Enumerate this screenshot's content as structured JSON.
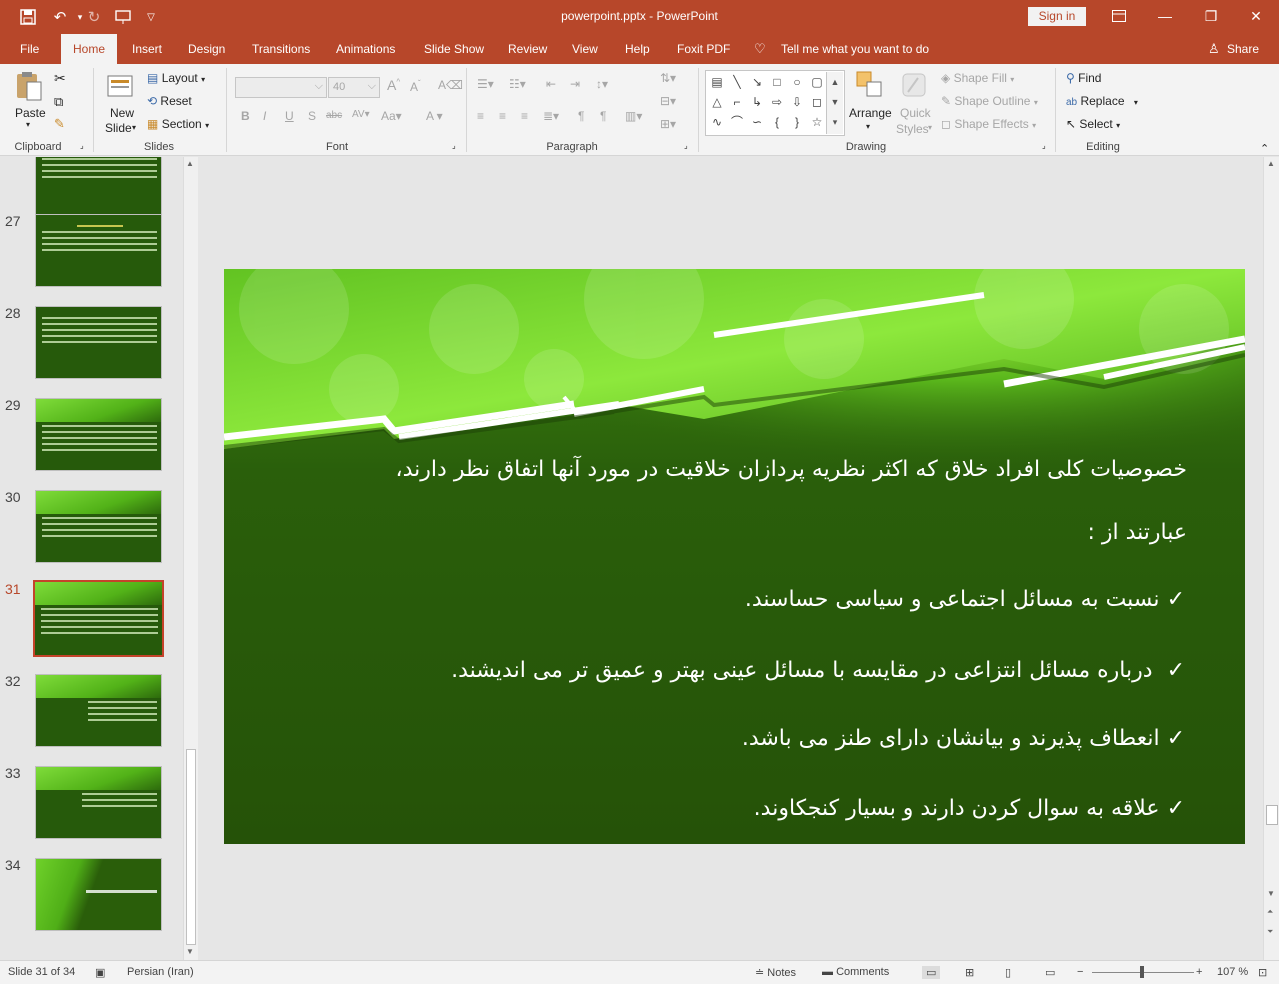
{
  "window": {
    "doc_title": "powerpoint.pptx  -  PowerPoint",
    "signin": "Sign in"
  },
  "tabs": [
    "File",
    "Home",
    "Insert",
    "Design",
    "Transitions",
    "Animations",
    "Slide Show",
    "Review",
    "View",
    "Help",
    "Foxit PDF"
  ],
  "active_tab": "Home",
  "tellme": "Tell me what you want to do",
  "share": "Share",
  "ribbon": {
    "clipboard": {
      "paste": "Paste",
      "label": "Clipboard"
    },
    "slides": {
      "new_slide": "New",
      "new_slide2": "Slide",
      "layout": "Layout",
      "reset": "Reset",
      "section": "Section",
      "label": "Slides"
    },
    "font": {
      "size": "40",
      "label": "Font"
    },
    "paragraph": {
      "label": "Paragraph"
    },
    "drawing": {
      "arrange": "Arrange",
      "quick_styles1": "Quick",
      "quick_styles2": "Styles",
      "shape_fill": "Shape Fill",
      "shape_outline": "Shape Outline",
      "shape_effects": "Shape Effects",
      "label": "Drawing"
    },
    "editing": {
      "find": "Find",
      "replace": "Replace",
      "select": "Select",
      "label": "Editing"
    }
  },
  "thumbnails": [
    {
      "num": "27"
    },
    {
      "num": "28"
    },
    {
      "num": "29"
    },
    {
      "num": "30"
    },
    {
      "num": "31"
    },
    {
      "num": "32"
    },
    {
      "num": "33"
    },
    {
      "num": "34"
    }
  ],
  "slide": {
    "line1": "خصوصیات کلی افراد خلاق که اکثر نظریه پردازان خلاقیت در مورد آنها اتفاق نظر دارند،",
    "line2": "عبارتند از :",
    "bullets": [
      "نسبت به مسائل اجتماعی و سیاسی حساسند.",
      "درباره مسائل انتزاعی در مقایسه با مسائل عینی بهتر و عمیق تر می اندیشند.",
      "انعطاف پذیرند و بیانشان دارای طنز می باشد.",
      "علاقه به سوال کردن دارند و بسیار کنجکاوند."
    ],
    "check": "✓"
  },
  "status": {
    "slide_of": "Slide 31 of 34",
    "language": "Persian (Iran)",
    "notes": "Notes",
    "comments": "Comments",
    "zoom": "107 %"
  },
  "colors": {
    "accent": "#b7472a",
    "slide_bg": "#2a5e0a",
    "slide_band": "#6fd12a"
  }
}
